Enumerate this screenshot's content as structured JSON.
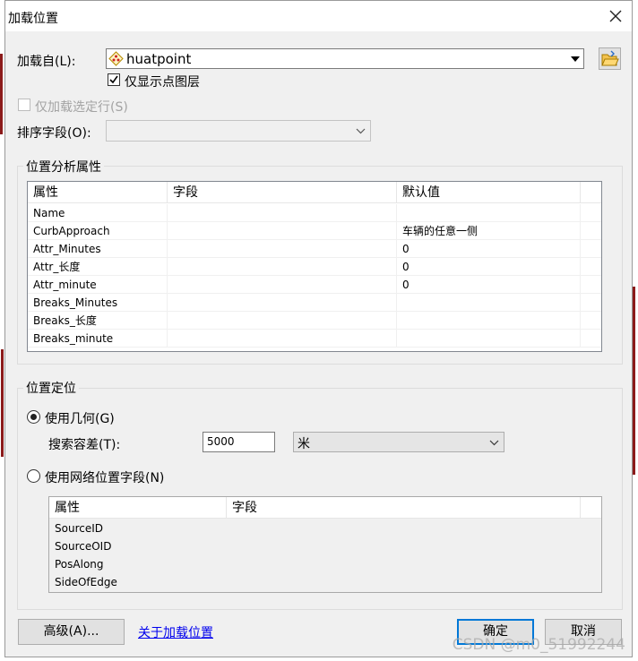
{
  "dialog": {
    "title": "加载位置"
  },
  "load_from": {
    "label": "加载自(L):",
    "value": "huatpoint",
    "only_points_label": "仅显示点图层",
    "only_points_checked": true
  },
  "only_selected": {
    "label": "仅加载选定行(S)",
    "checked": false
  },
  "sort_field": {
    "label": "排序字段(O):",
    "value": ""
  },
  "location_props": {
    "title": "位置分析属性",
    "columns": [
      "属性",
      "字段",
      "默认值"
    ],
    "rows": [
      {
        "property": "Name",
        "field": "",
        "default": ""
      },
      {
        "property": "CurbApproach",
        "field": "",
        "default": "车辆的任意一侧"
      },
      {
        "property": "Attr_Minutes",
        "field": "",
        "default": "0"
      },
      {
        "property": "Attr_长度",
        "field": "",
        "default": "0"
      },
      {
        "property": "Attr_minute",
        "field": "",
        "default": "0"
      },
      {
        "property": "Breaks_Minutes",
        "field": "",
        "default": ""
      },
      {
        "property": "Breaks_长度",
        "field": "",
        "default": ""
      },
      {
        "property": "Breaks_minute",
        "field": "",
        "default": ""
      }
    ]
  },
  "location_position": {
    "title": "位置定位",
    "use_geometry_label": "使用几何(G)",
    "use_geometry_selected": true,
    "search_tolerance_label": "搜索容差(T):",
    "search_tolerance_value": "5000",
    "units_value": "米",
    "use_network_label": "使用网络位置字段(N)",
    "use_network_selected": false,
    "columns": [
      "属性",
      "字段"
    ],
    "rows": [
      {
        "property": "SourceID",
        "field": ""
      },
      {
        "property": "SourceOID",
        "field": ""
      },
      {
        "property": "PosAlong",
        "field": ""
      },
      {
        "property": "SideOfEdge",
        "field": ""
      }
    ]
  },
  "buttons": {
    "advanced": "高级(A)...",
    "about_link": "关于加载位置",
    "ok": "确定",
    "cancel": "取消"
  },
  "watermark": "CSDN @m0_51992244",
  "colors": {
    "accent": "#0078d7",
    "background_lines": "#8b1a1a"
  }
}
